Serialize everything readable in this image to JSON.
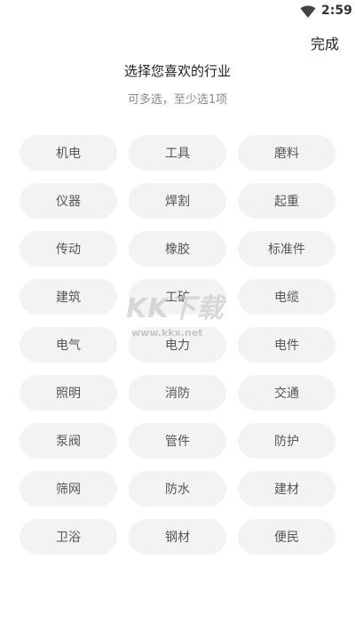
{
  "status_bar": {
    "time": "2:59",
    "wifi_icon": "wifi-icon"
  },
  "header": {
    "done_label": "完成"
  },
  "main": {
    "title": "选择您喜欢的行业",
    "subtitle": "可多选，至少选1项",
    "industries": [
      "机电",
      "工具",
      "磨料",
      "仪器",
      "焊割",
      "起重",
      "传动",
      "橡胶",
      "标准件",
      "建筑",
      "工矿",
      "电缆",
      "电气",
      "电力",
      "电件",
      "照明",
      "消防",
      "交通",
      "泵阀",
      "管件",
      "防护",
      "筛网",
      "防水",
      "建材",
      "卫浴",
      "钢材",
      "便民"
    ]
  },
  "watermark": {
    "big": "KK下载",
    "small": "www.kkx.net"
  },
  "colors": {
    "chip_bg": "#f3f3f3",
    "chip_text": "#555555",
    "title_text": "#222222",
    "subtitle_text": "#8a8a8a"
  }
}
